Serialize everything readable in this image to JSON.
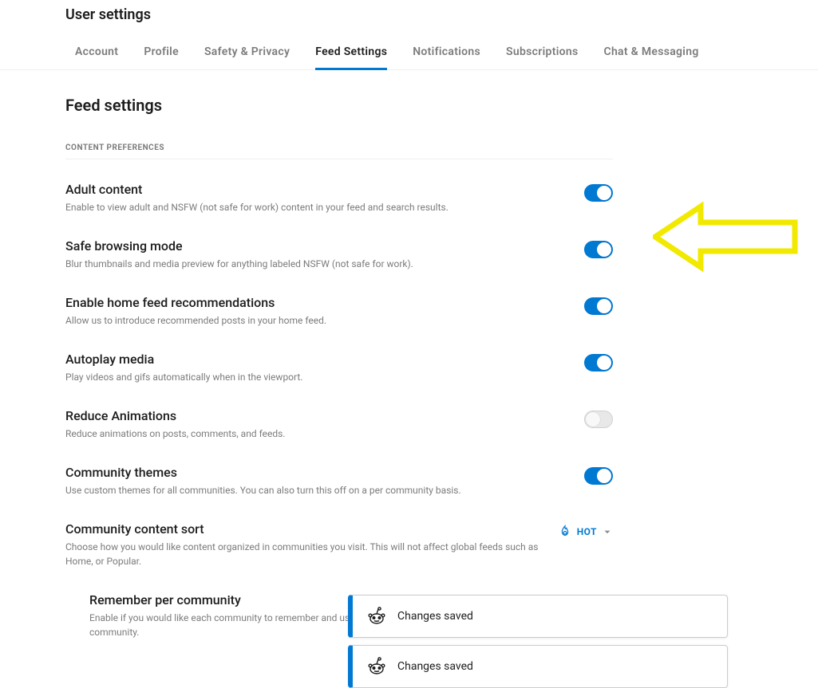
{
  "page_title": "User settings",
  "tabs": [
    {
      "label": "Account",
      "active": false
    },
    {
      "label": "Profile",
      "active": false
    },
    {
      "label": "Safety & Privacy",
      "active": false
    },
    {
      "label": "Feed Settings",
      "active": true
    },
    {
      "label": "Notifications",
      "active": false
    },
    {
      "label": "Subscriptions",
      "active": false
    },
    {
      "label": "Chat & Messaging",
      "active": false
    }
  ],
  "section_title": "Feed settings",
  "section_header": "CONTENT PREFERENCES",
  "settings": {
    "adult": {
      "label": "Adult content",
      "desc": "Enable to view adult and NSFW (not safe for work) content in your feed and search results.",
      "on": true
    },
    "safe": {
      "label": "Safe browsing mode",
      "desc": "Blur thumbnails and media preview for anything labeled NSFW (not safe for work).",
      "on": true
    },
    "recs": {
      "label": "Enable home feed recommendations",
      "desc": "Allow us to introduce recommended posts in your home feed.",
      "on": true
    },
    "autoplay": {
      "label": "Autoplay media",
      "desc": "Play videos and gifs automatically when in the viewport.",
      "on": true
    },
    "reduce": {
      "label": "Reduce Animations",
      "desc": "Reduce animations on posts, comments, and feeds.",
      "on": false
    },
    "themes": {
      "label": "Community themes",
      "desc": "Use custom themes for all communities. You can also turn this off on a per community basis.",
      "on": true
    },
    "sort": {
      "label": "Community content sort",
      "desc": "Choose how you would like content organized in communities you visit. This will not affect global feeds such as Home, or Popular.",
      "value": "HOT"
    },
    "remember": {
      "label": "Remember per community",
      "desc": "Enable if you would like each community to remember and use the last content sort you selected for that community.",
      "on": false
    }
  },
  "toast": {
    "message": "Changes saved"
  },
  "colors": {
    "accent": "#0079d3",
    "arrow": "#f2e900"
  }
}
